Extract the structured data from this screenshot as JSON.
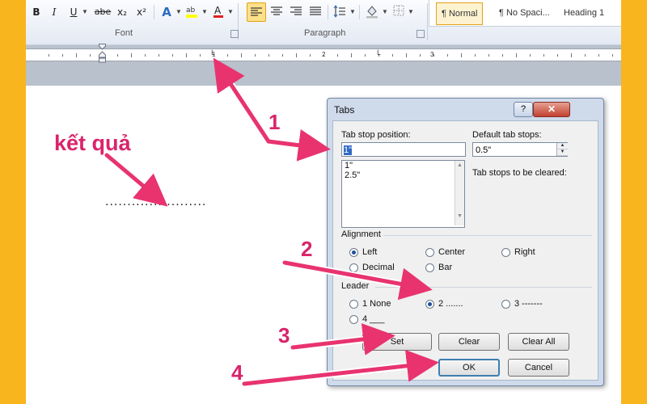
{
  "ribbon": {
    "format_buttons": [
      "B",
      "I",
      "U",
      "abe",
      "x₂",
      "x²"
    ],
    "font_group_label": "Font",
    "paragraph_group_label": "Paragraph",
    "styles": [
      "¶ Normal",
      "¶ No Spaci...",
      "Heading 1"
    ]
  },
  "ruler": {
    "numbers": [
      "1",
      "2",
      "3"
    ]
  },
  "document": {
    "annotation_text": "kết quả",
    "leader_preview": "......................."
  },
  "annotations": {
    "n1": "1",
    "n2": "2",
    "n3": "3",
    "n4": "4",
    "color": "#d9246b"
  },
  "dialog": {
    "title": "Tabs",
    "help": "?",
    "tab_stop_position_label": "Tab stop position:",
    "tab_stop_value": "1\"",
    "tab_stops": [
      "1\"",
      "2.5\""
    ],
    "default_tab_stops_label": "Default tab stops:",
    "default_tab_stops_value": "0.5\"",
    "tab_stops_cleared_label": "Tab stops to be cleared:",
    "alignment_label": "Alignment",
    "alignment": {
      "left": "Left",
      "center": "Center",
      "right": "Right",
      "decimal": "Decimal",
      "bar": "Bar",
      "selected": "Left"
    },
    "leader_label": "Leader",
    "leader": {
      "opt1": "1 None",
      "opt2": "2 .......",
      "opt3": "3 -------",
      "opt4": "4 ___",
      "selected": "2"
    },
    "buttons": {
      "set": "Set",
      "clear": "Clear",
      "clear_all": "Clear All",
      "ok": "OK",
      "cancel": "Cancel"
    }
  }
}
